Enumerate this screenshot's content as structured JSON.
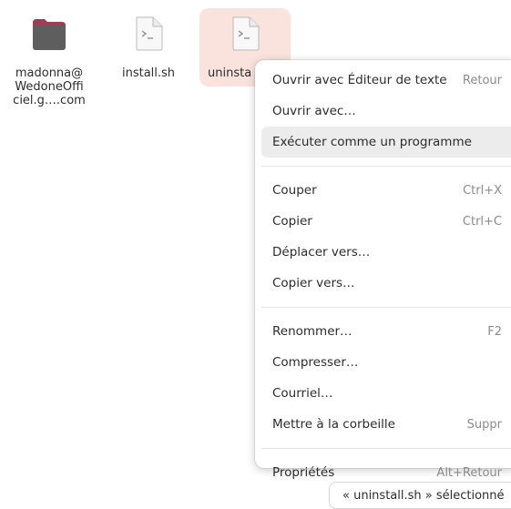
{
  "files": [
    {
      "id": "folder",
      "label": "madonna@\nWedoneOffi\nciel.g….com",
      "icon": "folder-icon",
      "color": "#5e5e5e",
      "accent": "#a13c57"
    },
    {
      "id": "install",
      "label": "install.sh",
      "icon": "script-file-icon"
    },
    {
      "id": "uninstall",
      "label": "uninsta",
      "icon": "script-file-icon",
      "selected": true
    }
  ],
  "context_menu": {
    "groups": [
      [
        {
          "label": "Ouvrir avec Éditeur de texte",
          "accel": "Retour"
        },
        {
          "label": "Ouvrir avec…",
          "accel": ""
        },
        {
          "label": "Exécuter comme un programme",
          "accel": "",
          "hover": true
        }
      ],
      [
        {
          "label": "Couper",
          "accel": "Ctrl+X"
        },
        {
          "label": "Copier",
          "accel": "Ctrl+C"
        },
        {
          "label": "Déplacer vers…",
          "accel": ""
        },
        {
          "label": "Copier vers…",
          "accel": ""
        }
      ],
      [
        {
          "label": "Renommer…",
          "accel": "F2"
        },
        {
          "label": "Compresser…",
          "accel": ""
        },
        {
          "label": "Courriel…",
          "accel": ""
        },
        {
          "label": "Mettre à la corbeille",
          "accel": "Suppr"
        }
      ],
      [
        {
          "label": "Propriétés",
          "accel": "Alt+Retour"
        }
      ]
    ]
  },
  "status": {
    "text": "« uninstall.sh » sélectionné"
  },
  "colors": {
    "selection": "#fbe3dd",
    "hover": "#ececec",
    "accel": "#8a8a8a"
  }
}
